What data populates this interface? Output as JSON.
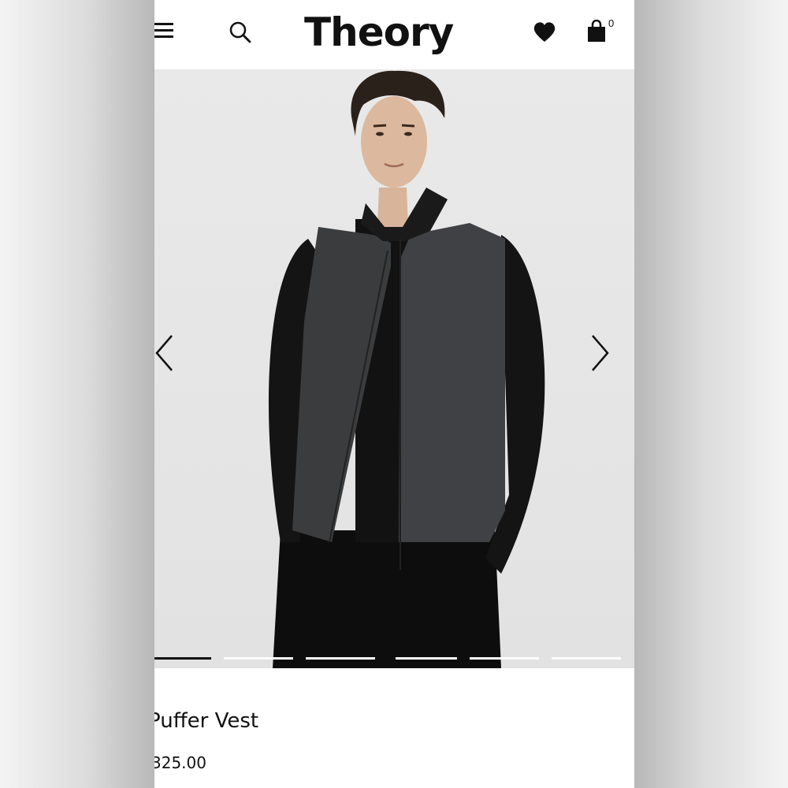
{
  "header": {
    "logo": "Theory",
    "bag_count": "0",
    "icons": [
      "menu-icon",
      "search-icon",
      "heart-icon",
      "shopping-bag-icon"
    ]
  },
  "carousel": {
    "image_count": 6,
    "active_index": 0,
    "prev_icon": "chevron-left-icon",
    "next_icon": "chevron-right-icon"
  },
  "product": {
    "name": "Puffer Vest",
    "price": "325.00"
  },
  "colors": {
    "text": "#111111",
    "background": "#ffffff",
    "hero_bg": "#e6e6e6",
    "vest": "#3b3c3e"
  }
}
